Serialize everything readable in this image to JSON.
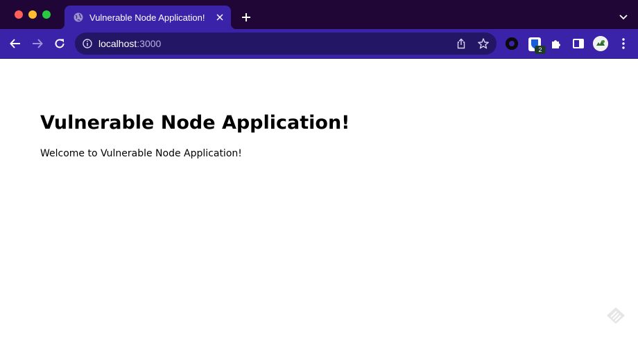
{
  "browser": {
    "tab": {
      "title": "Vulnerable Node Application!"
    },
    "address_bar": {
      "host": "localhost",
      "port": ":3000"
    },
    "extensions": {
      "bitwarden_badge": "2"
    },
    "colors": {
      "tabstrip": "#1f0636",
      "toolbar": "#3a23a8",
      "omnibox": "#231765"
    },
    "icons": [
      "globe-icon",
      "close-icon",
      "plus-icon",
      "chevron-down-icon",
      "back-arrow-icon",
      "forward-arrow-icon",
      "reload-icon",
      "info-icon",
      "share-icon",
      "star-icon",
      "extension-icon",
      "bitwarden-shield-icon",
      "puzzle-icon",
      "side-panel-icon",
      "avatar",
      "kebab-menu-icon"
    ]
  },
  "page": {
    "heading": "Vulnerable Node Application!",
    "welcome_text": "Welcome to Vulnerable Node Application!"
  }
}
